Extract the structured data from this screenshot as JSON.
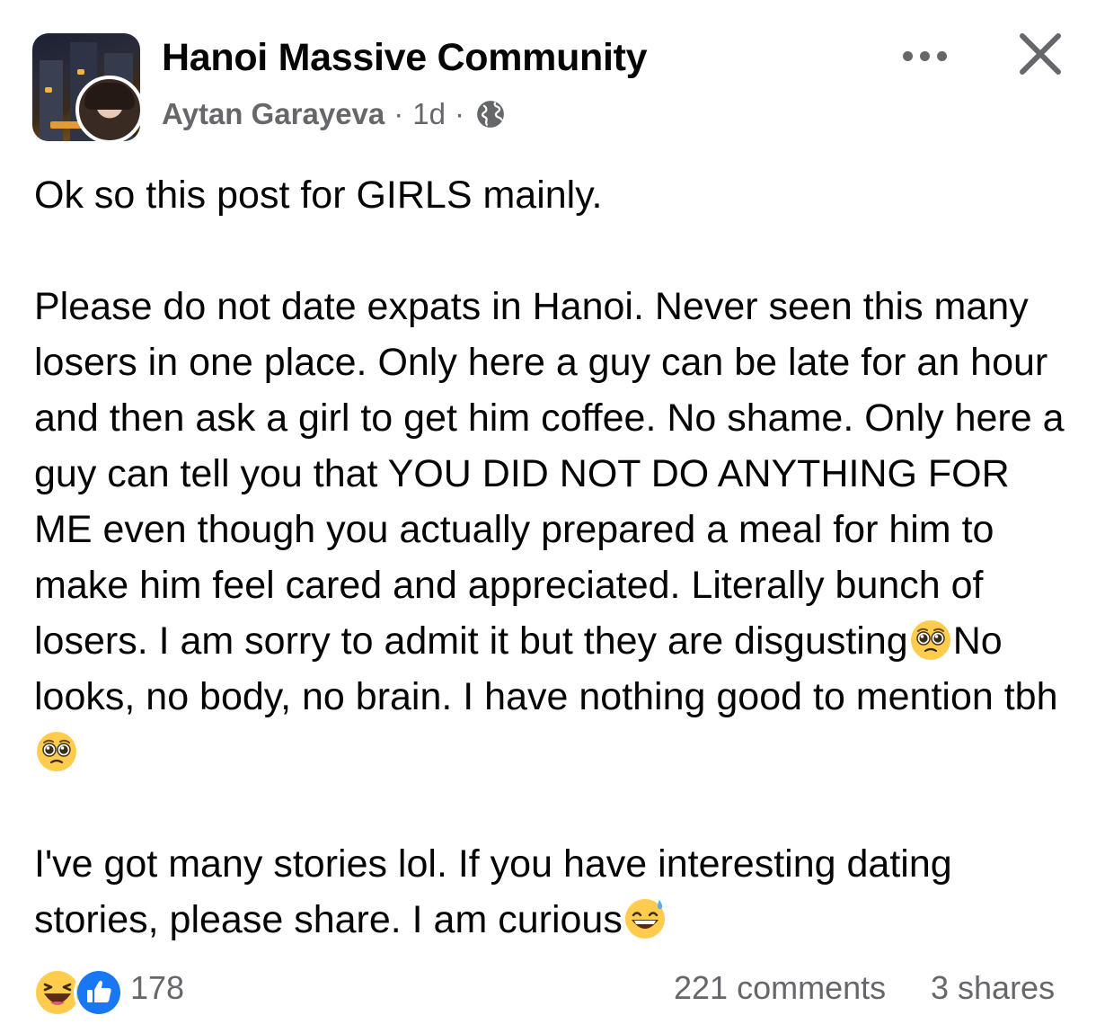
{
  "post": {
    "group_name": "Hanoi Massive Community",
    "author": "Aytan Garayeva",
    "separator": "·",
    "time": "1d",
    "audience_icon": "globe-icon",
    "header_actions": {
      "more_icon": "more-options-icon",
      "close_icon": "close-icon"
    },
    "paragraphs": [
      {
        "segments": [
          {
            "text": "Ok so this post for GIRLS mainly."
          }
        ]
      },
      {
        "segments": [
          {
            "text": "Please do not date expats in Hanoi. Never seen this many losers in one place. Only here a guy can be late for an hour and then ask a girl to get him coffee. No shame. Only here a guy can tell you that YOU DID NOT DO ANYTHING FOR ME even though you actually prepared a meal for him to make him feel cared and appreciated. Literally bunch of losers. I am sorry to admit it but they are disgusting"
          },
          {
            "emoji": "pleading-face"
          },
          {
            "text": "No looks, no body, no brain. I have nothing good to mention tbh"
          },
          {
            "emoji": "pleading-face"
          }
        ]
      },
      {
        "segments": [
          {
            "text": "I've got many stories lol. If you have interesting dating stories, please share. I am curious"
          },
          {
            "emoji": "grinning-face-with-sweat"
          }
        ]
      }
    ]
  },
  "footer": {
    "reactions": [
      "haha",
      "like"
    ],
    "reaction_count": "178",
    "comments": "221 comments",
    "shares": "3 shares"
  },
  "colors": {
    "text_primary": "#050505",
    "text_secondary": "#65676b",
    "like_blue": "#1877f2",
    "emoji_yellow": "#ffcc4d"
  }
}
